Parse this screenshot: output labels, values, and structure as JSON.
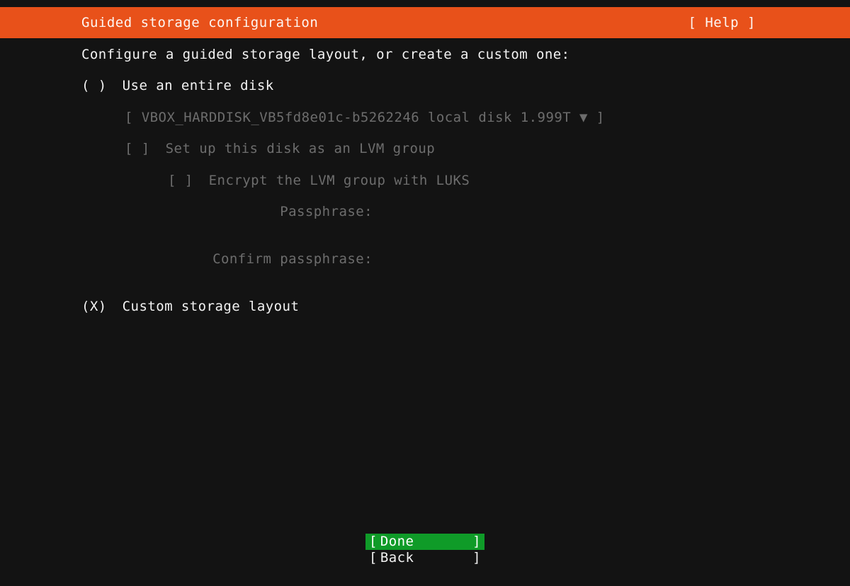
{
  "colors": {
    "header_bg": "#e8511a",
    "screen_bg": "#131313",
    "bright_text": "#f2f2f2",
    "dim_text": "#6d6d6d",
    "selected_button_bg": "#0f9b28",
    "selected_button_text": "#ffffff"
  },
  "header": {
    "title": "Guided storage configuration",
    "help_label": "[ Help ]"
  },
  "main": {
    "intro": "Configure a guided storage layout, or create a custom one:",
    "options": [
      {
        "marker": "( )",
        "label": "Use an entire disk",
        "selected": false,
        "state": "bright"
      },
      {
        "marker": "(X)",
        "label": "Custom storage layout",
        "selected": true,
        "state": "bright"
      }
    ],
    "disk_selector": {
      "open_bracket": "[",
      "value": "VBOX_HARDDISK_VB5fd8e01c-b5262246 local disk 1.999T",
      "caret": "▼",
      "close_bracket": "]",
      "state": "dim"
    },
    "lvm_checkbox": {
      "marker": "[ ]",
      "label": "Set up this disk as an LVM group",
      "checked": false,
      "state": "dim"
    },
    "luks_checkbox": {
      "marker": "[ ]",
      "label": "Encrypt the LVM group with LUKS",
      "checked": false,
      "state": "dim"
    },
    "passphrase_label": "Passphrase:",
    "passphrase_value": "",
    "confirm_passphrase_label": "Confirm passphrase:",
    "confirm_passphrase_value": ""
  },
  "footer": {
    "buttons": [
      {
        "open_bracket": "[",
        "label": "Done",
        "close_bracket": "]",
        "selected": true
      },
      {
        "open_bracket": "[",
        "label": "Back",
        "close_bracket": "]",
        "selected": false
      }
    ]
  }
}
